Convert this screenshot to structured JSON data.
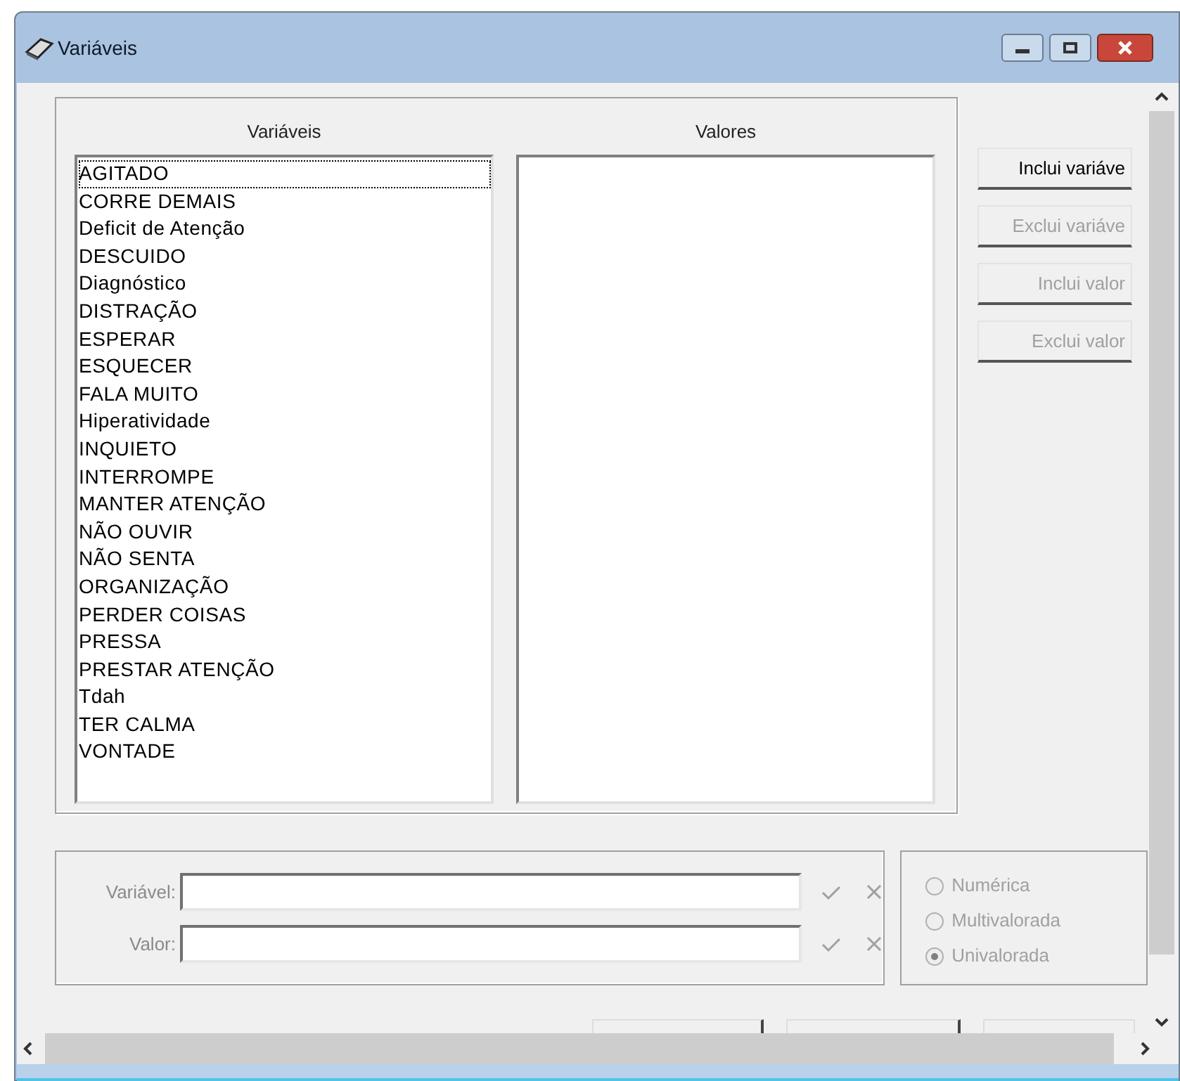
{
  "window": {
    "title": "Variáveis"
  },
  "variables": {
    "heading": "Variáveis",
    "items": [
      {
        "label": "AGITADO",
        "selected": true
      },
      {
        "label": "CORRE DEMAIS",
        "selected": false
      },
      {
        "label": "Deficit de Atenção",
        "selected": false
      },
      {
        "label": "DESCUIDO",
        "selected": false
      },
      {
        "label": "Diagnóstico",
        "selected": false
      },
      {
        "label": "DISTRAÇÃO",
        "selected": false
      },
      {
        "label": "ESPERAR",
        "selected": false
      },
      {
        "label": "ESQUECER",
        "selected": false
      },
      {
        "label": "FALA MUITO",
        "selected": false
      },
      {
        "label": "Hiperatividade",
        "selected": false
      },
      {
        "label": "INQUIETO",
        "selected": false
      },
      {
        "label": "INTERROMPE",
        "selected": false
      },
      {
        "label": "MANTER ATENÇÃO",
        "selected": false
      },
      {
        "label": "NÃO OUVIR",
        "selected": false
      },
      {
        "label": "NÃO SENTA",
        "selected": false
      },
      {
        "label": "ORGANIZAÇÃO",
        "selected": false
      },
      {
        "label": "PERDER COISAS",
        "selected": false
      },
      {
        "label": "PRESSA",
        "selected": false
      },
      {
        "label": "PRESTAR ATENÇÃO",
        "selected": false
      },
      {
        "label": "Tdah",
        "selected": false
      },
      {
        "label": "TER CALMA",
        "selected": false
      },
      {
        "label": "VONTADE",
        "selected": false
      }
    ]
  },
  "values": {
    "heading": "Valores"
  },
  "actions": [
    {
      "label": "Inclui variáve",
      "disabled": false
    },
    {
      "label": "Exclui variáve",
      "disabled": true
    },
    {
      "label": "Inclui valor",
      "disabled": true
    },
    {
      "label": "Exclui valor",
      "disabled": true
    }
  ],
  "fields": [
    {
      "label": "Variável:",
      "disabled": true
    },
    {
      "label": "Valor:",
      "disabled": true
    }
  ],
  "types": [
    {
      "label": "Numérica",
      "selected": false,
      "disabled": true
    },
    {
      "label": "Multivalorada",
      "selected": false,
      "disabled": true
    },
    {
      "label": "Univalorada",
      "selected": true,
      "disabled": true
    }
  ]
}
